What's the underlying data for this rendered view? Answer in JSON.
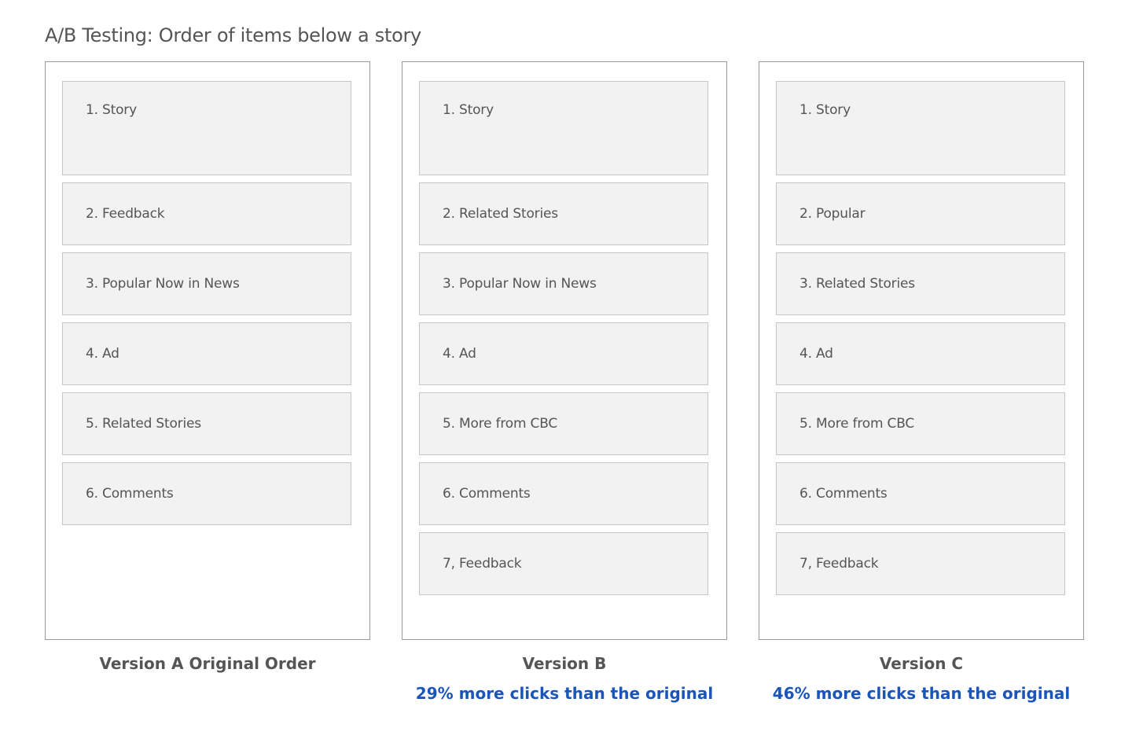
{
  "title": "A/B Testing: Order of items below a story",
  "colors": {
    "text": "#555555",
    "item_bg": "#f2f2f2",
    "item_border": "#c6c6c6",
    "frame_border": "#9a9a9a",
    "accent_blue": "#1a56b8"
  },
  "versions": [
    {
      "caption": "Version A Original Order",
      "result": "",
      "items": [
        "1. Story",
        "2. Feedback",
        "3. Popular Now in News",
        "4. Ad",
        "5. Related Stories",
        "6. Comments"
      ]
    },
    {
      "caption": "Version B",
      "result": "29% more clicks than the original",
      "items": [
        "1. Story",
        "2. Related Stories",
        "3. Popular Now in News",
        "4. Ad",
        "5. More from CBC",
        "6. Comments",
        "7, Feedback"
      ]
    },
    {
      "caption": "Version C",
      "result": "46% more clicks than the original",
      "items": [
        "1. Story",
        "2. Popular",
        "3. Related Stories",
        "4. Ad",
        "5. More from CBC",
        "6. Comments",
        "7, Feedback"
      ]
    }
  ]
}
